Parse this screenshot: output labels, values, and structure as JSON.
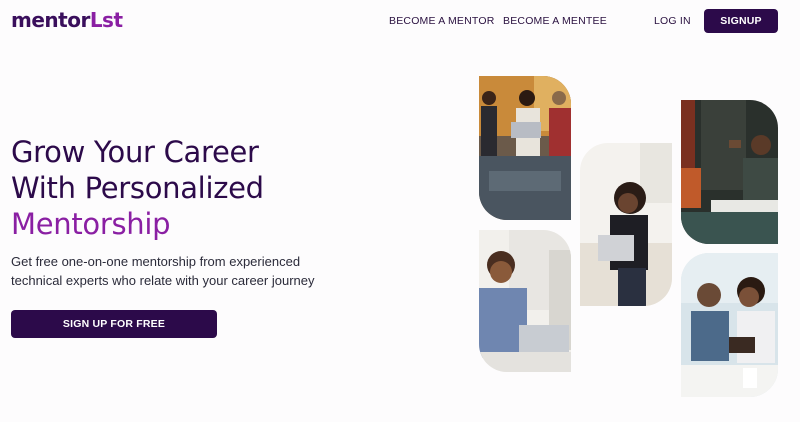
{
  "brand": {
    "logo_main": "mentor",
    "logo_accent": "Lst"
  },
  "nav": {
    "become_mentor": "BECOME A MENTOR",
    "become_mentee": "BECOME A MENTEE",
    "login": "LOG IN",
    "signup": "SIGNUP"
  },
  "hero": {
    "title_line1": "Grow Your Career",
    "title_line2": "With Personalized",
    "title_highlight": "Mentorship",
    "subtitle_line1": "Get free one-on-one mentorship from experienced",
    "subtitle_line2": "technical experts who relate with your career journey",
    "cta": "SIGN UP FOR FREE"
  },
  "photos": [
    {
      "name": "group-laptops-photo"
    },
    {
      "name": "man-laptop-photo"
    },
    {
      "name": "woman-laptop-photo"
    },
    {
      "name": "discussion-photo"
    },
    {
      "name": "mentoring-pair-photo"
    }
  ],
  "colors": {
    "primary": "#2c0a4a",
    "accent": "#8a1fa3",
    "background": "#fdfcfd"
  }
}
